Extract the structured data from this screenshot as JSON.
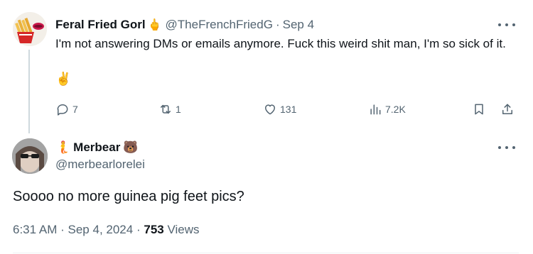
{
  "parent_tweet": {
    "author_name": "Feral Fried Gorl",
    "author_emoji": "🖕",
    "handle": "@TheFrenchFriedG",
    "separator": "·",
    "date": "Sep 4",
    "text": "I'm not answering DMs or emails anymore. Fuck this weird shit man, I'm so sick of it.",
    "text_emoji": "✌️",
    "actions": {
      "replies": "7",
      "retweets": "1",
      "likes": "131",
      "views": "7.2K"
    }
  },
  "reply_tweet": {
    "leading_emoji": "🧜",
    "author_name": "Merbear",
    "trailing_emoji": "🐻",
    "handle": "@merbearlorelei",
    "text": "Soooo no more guinea pig feet pics?",
    "time": "6:31 AM",
    "sep1": "·",
    "date": "Sep 4, 2024",
    "sep2": "·",
    "views_count": "753",
    "views_label": "Views"
  },
  "colors": {
    "text": "#0f1419",
    "secondary": "#536471",
    "thread_line": "#cfd9de"
  }
}
